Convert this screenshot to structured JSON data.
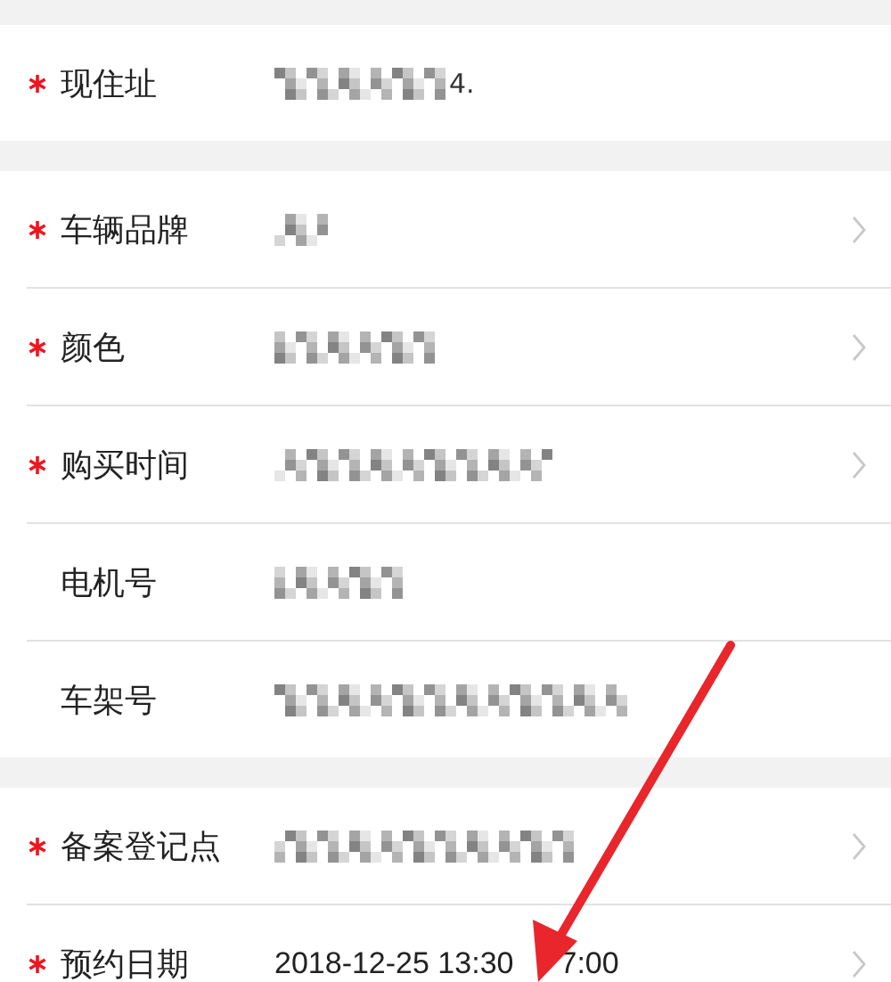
{
  "sections": [
    {
      "rows": [
        {
          "label": "现住址",
          "required": true,
          "kind": "mosaic",
          "visible_text": "4.",
          "chevron": false
        }
      ]
    },
    {
      "rows": [
        {
          "label": "车辆品牌",
          "required": true,
          "kind": "mosaic",
          "chevron": true
        },
        {
          "label": "颜色",
          "required": true,
          "kind": "mosaic",
          "chevron": true
        },
        {
          "label": "购买时间",
          "required": true,
          "kind": "mosaic",
          "chevron": true
        },
        {
          "label": "电机号",
          "required": false,
          "kind": "mosaic",
          "chevron": false
        },
        {
          "label": "车架号",
          "required": false,
          "kind": "mosaic",
          "chevron": false
        }
      ]
    },
    {
      "rows": [
        {
          "label": "备案登记点",
          "required": true,
          "kind": "mosaic",
          "chevron": true
        },
        {
          "label": "预约日期",
          "required": true,
          "kind": "text",
          "value": "2018-12-25 13:30",
          "value_after_arrow": "7:00",
          "chevron": true
        }
      ]
    }
  ]
}
